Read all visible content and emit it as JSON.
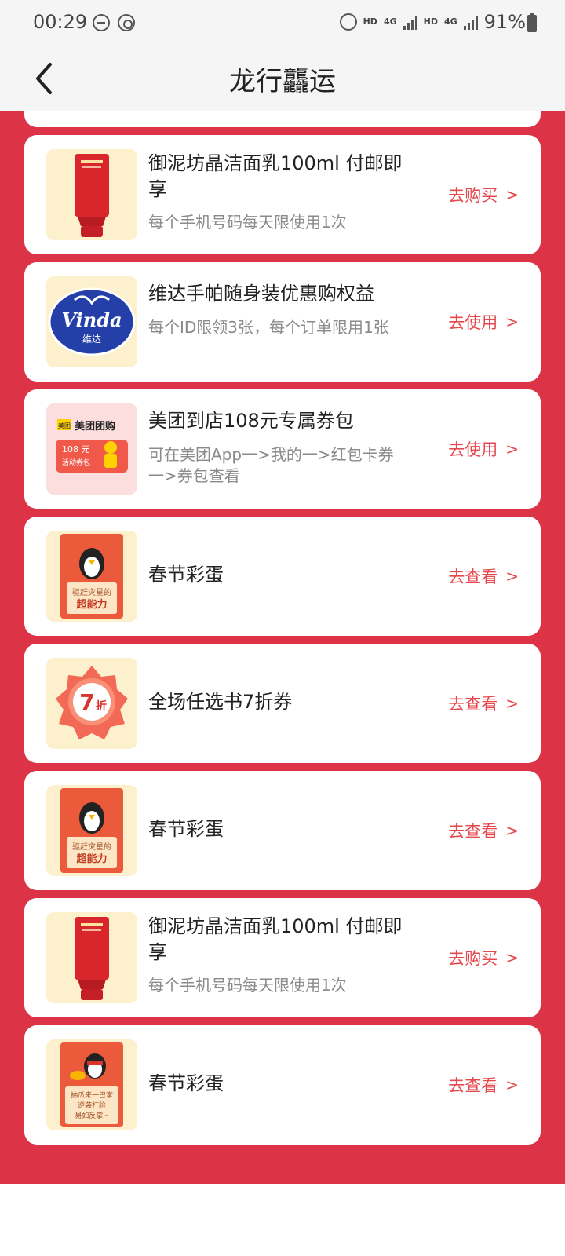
{
  "status": {
    "time": "00:29",
    "network1": "HD",
    "gen1": "4G",
    "network2": "HD",
    "gen2": "4G",
    "battery": "91%"
  },
  "header": {
    "title": "龙行龘运"
  },
  "cards": [
    {
      "title": "御泥坊晶洁面乳100ml 付邮即享",
      "subtitle": "每个手机号码每天限使用1次",
      "action": "去购买",
      "arrow": ">",
      "image": "red-tube-cleanser"
    },
    {
      "title": "维达手帕随身装优惠购权益",
      "subtitle": "每个ID限领3张，每个订单限用1张",
      "action": "去使用",
      "arrow": ">",
      "image": "vinda-logo",
      "logo_text": "Vinda",
      "logo_sub": "维达"
    },
    {
      "title": "美团到店108元专属券包",
      "subtitle": "可在美团App一>我的一>红包卡券一>券包查看",
      "action": "去使用",
      "arrow": ">",
      "image": "meituan-coupon",
      "brand_tag": "美团",
      "brand_name": "美团团购",
      "coupon_amount": "108 元",
      "coupon_label": "活动券包"
    },
    {
      "title": "春节彩蛋",
      "subtitle": "",
      "action": "去查看",
      "arrow": ">",
      "image": "penguin-card",
      "card_line1": "驱赶灾星的",
      "card_line2": "超能力"
    },
    {
      "title": "全场任选书7折券",
      "subtitle": "",
      "action": "去查看",
      "arrow": ">",
      "image": "discount-badge",
      "badge_num": "7",
      "badge_unit": "折"
    },
    {
      "title": "春节彩蛋",
      "subtitle": "",
      "action": "去查看",
      "arrow": ">",
      "image": "penguin-card",
      "card_line1": "驱赶灾星的",
      "card_line2": "超能力"
    },
    {
      "title": "御泥坊晶洁面乳100ml 付邮即享",
      "subtitle": "每个手机号码每天限使用1次",
      "action": "去购买",
      "arrow": ">",
      "image": "red-tube-cleanser"
    },
    {
      "title": "春节彩蛋",
      "subtitle": "",
      "action": "去查看",
      "arrow": ">",
      "image": "penguin-card-2",
      "card_line1": "抽瓜来一巴掌",
      "card_line2": "逆袭打脸",
      "card_line3": "易如反掌~"
    }
  ],
  "colors": {
    "panel_red": "#dc3346",
    "action_red": "#e5484d",
    "thumb_bg": "#fdf0cd"
  }
}
